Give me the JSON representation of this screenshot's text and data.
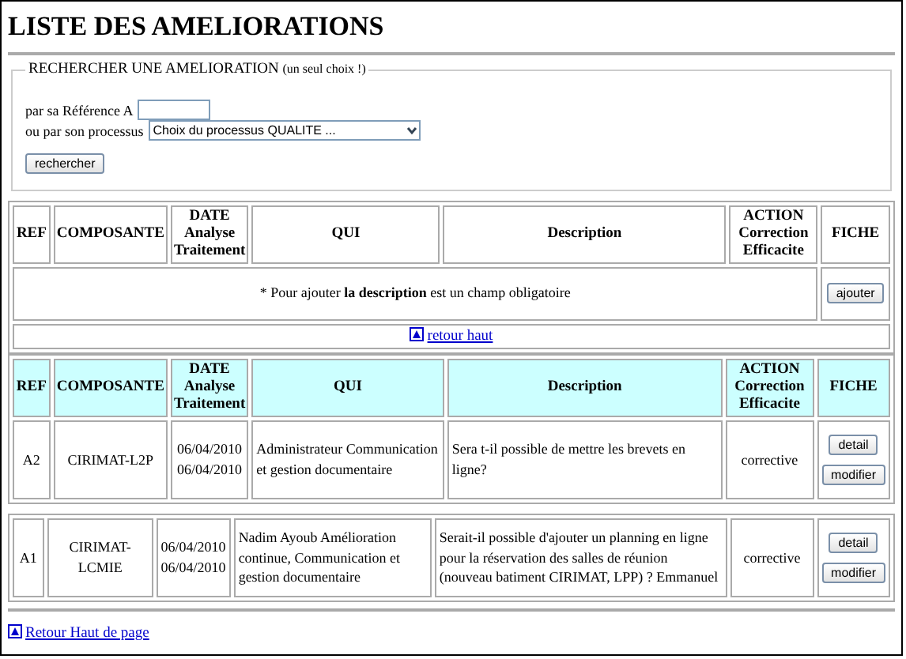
{
  "title": "LISTE DES AMELIORATIONS",
  "search": {
    "legend": "RECHERCHER UNE AMELIORATION",
    "legend_note": "(un seul choix !)",
    "ref_label": "par sa Référence A",
    "process_label": "ou par son processus",
    "process_value": "Choix du processus QUALITE ...",
    "button": "rechercher"
  },
  "add_table": {
    "columns": [
      "REF",
      "COMPOSANTE",
      "DATE Analyse Traitement",
      "QUI",
      "Description",
      "ACTION Correction Efficacite",
      "FICHE"
    ],
    "note": "* Pour ajouter **la description** est un champ obligatoire",
    "button": "ajouter"
  },
  "back_top": "retour haut",
  "list_table": {
    "columns": [
      "REF",
      "COMPOSANTE",
      "DATE Analyse Traitement",
      "QUI",
      "Description",
      "ACTION Correction Efficacite",
      "FICHE"
    ]
  },
  "rows": [
    {
      "ref": "A2",
      "composante": "CIRIMAT-L2P",
      "dates": [
        "06/04/2010",
        "06/04/2010"
      ],
      "qui": "Administrateur Communication et gestion documentaire",
      "description": "Sera t-il possible de mettre les brevets en ligne?",
      "action": "corrective",
      "buttons": [
        "detail",
        "modifier"
      ]
    },
    {
      "ref": "A1",
      "composante": "CIRIMAT-LCMIE",
      "dates": [
        "06/04/2010",
        "06/04/2010"
      ],
      "qui": "Nadim Ayoub Amélioration continue, Communication et gestion documentaire",
      "description": "Serait-il possible d'ajouter un planning en ligne pour la réservation des salles de réunion (nouveau batiment CIRIMAT, LPP) ? Emmanuel",
      "action": "corrective",
      "buttons": [
        "detail",
        "modifier"
      ]
    }
  ],
  "footer_link": "Retour Haut de page"
}
